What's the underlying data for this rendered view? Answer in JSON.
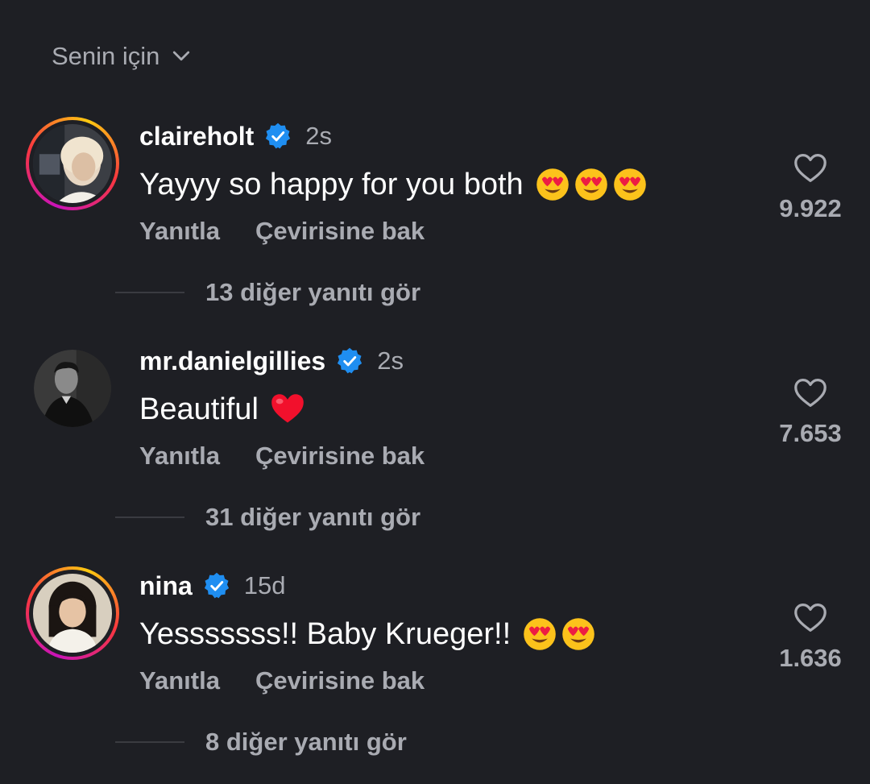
{
  "sort": {
    "label": "Senin için",
    "icon": "chevron-down-icon"
  },
  "comments": [
    {
      "username": "claireholt",
      "verified": true,
      "time": "2s",
      "text": "Yayyy so happy for you both",
      "emojis": [
        "😍",
        "😍",
        "😍"
      ],
      "reply_label": "Yanıtla",
      "translate_label": "Çevirisine bak",
      "likes": "9.922",
      "replies_label": "13 diğer yanıtı gör",
      "has_story": true
    },
    {
      "username": "mr.danielgillies",
      "verified": true,
      "time": "2s",
      "text": "Beautiful",
      "emojis": [
        "❤️"
      ],
      "reply_label": "Yanıtla",
      "translate_label": "Çevirisine bak",
      "likes": "7.653",
      "replies_label": "31 diğer yanıtı gör",
      "has_story": false
    },
    {
      "username": "nina",
      "verified": true,
      "time": "15d",
      "text": "Yesssssss!! Baby Krueger!!",
      "emojis": [
        "😍",
        "😍"
      ],
      "reply_label": "Yanıtla",
      "translate_label": "Çevirisine bak",
      "likes": "1.636",
      "replies_label": "8 diğer yanıtı gör",
      "has_story": true
    }
  ],
  "colors": {
    "background": "#1e1f24",
    "secondary_text": "#a9abb2",
    "verified_blue": "#1f8ef1"
  }
}
